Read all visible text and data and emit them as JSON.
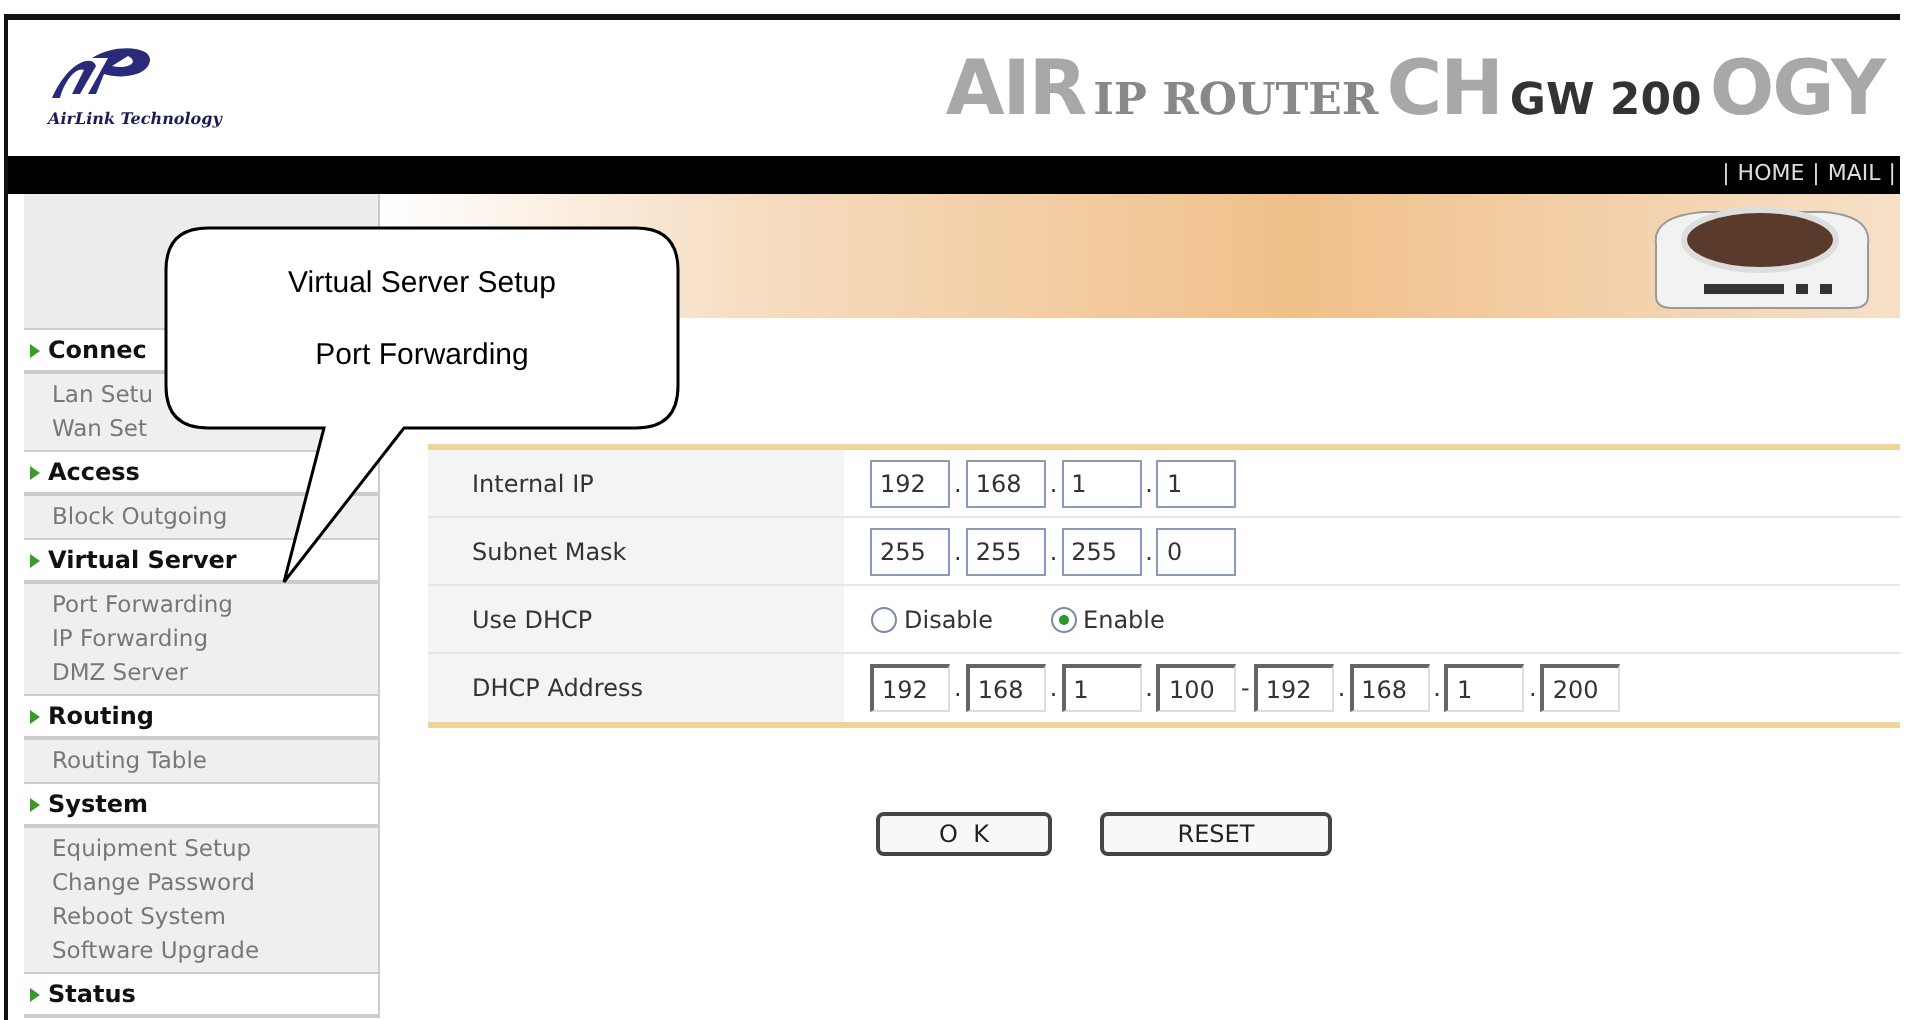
{
  "header": {
    "logo_text": "AirLink Technology",
    "title_parts": [
      {
        "text": "AIR",
        "kind": "faded"
      },
      {
        "text": "IP ROUTER",
        "kind": "serif"
      },
      {
        "text": "CH",
        "kind": "faded"
      },
      {
        "text": "GW 200",
        "kind": "strong"
      },
      {
        "text": "OGY",
        "kind": "faded"
      }
    ]
  },
  "nav": {
    "separator": "|",
    "links": [
      "HOME",
      "MAIL"
    ]
  },
  "sidebar": [
    {
      "title": "Connec",
      "items": [
        "Lan Setu",
        "Wan Set"
      ]
    },
    {
      "title": "Access",
      "items": [
        "Block Outgoing"
      ]
    },
    {
      "title": "Virtual Server",
      "items": [
        "Port Forwarding",
        "IP Forwarding",
        "DMZ Server"
      ]
    },
    {
      "title": "Routing",
      "items": [
        "Routing Table"
      ]
    },
    {
      "title": "System",
      "items": [
        "Equipment Setup",
        "Change Password",
        "Reboot System",
        "Software Upgrade"
      ]
    },
    {
      "title": "Status"
    }
  ],
  "form": {
    "rows": [
      {
        "kind": "ip",
        "label": "Internal IP",
        "separator": ".",
        "fields": [
          "192",
          "168",
          "1",
          "1"
        ]
      },
      {
        "kind": "ip",
        "label": "Subnet Mask",
        "separator": ".",
        "fields": [
          "255",
          "255",
          "255",
          "0"
        ]
      },
      {
        "kind": "radio",
        "label": "Use DHCP",
        "options": [
          {
            "label": "Disable",
            "selected": false
          },
          {
            "label": "Enable",
            "selected": true
          }
        ]
      },
      {
        "kind": "range",
        "label": "DHCP Address",
        "separator": ".",
        "range_separator": "-",
        "fields": [
          "192",
          "168",
          "1",
          "100"
        ],
        "fields_end": [
          "192",
          "168",
          "1",
          "200"
        ]
      }
    ]
  },
  "buttons": [
    "O  K",
    "RESET"
  ],
  "callout": {
    "lines": [
      "Virtual Server Setup",
      "Port Forwarding"
    ]
  }
}
